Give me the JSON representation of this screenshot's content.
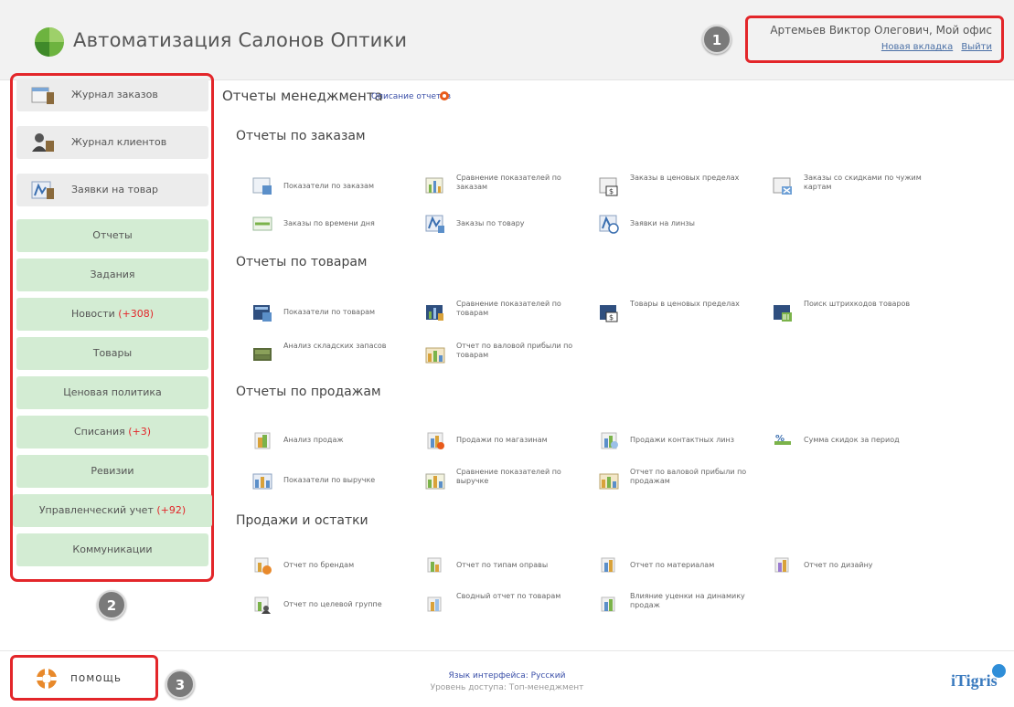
{
  "header": {
    "app_title": "Автоматизация Салонов Оптики",
    "user_name": "Артемьев Виктор Олегович, Мой офис",
    "new_tab": "Новая вкладка",
    "logout": "Выйти"
  },
  "badges": [
    "1",
    "2",
    "3"
  ],
  "sidebar": {
    "main_items": [
      {
        "label": "Журнал заказов",
        "icon": "orders-journal-icon"
      },
      {
        "label": "Журнал клиентов",
        "icon": "clients-journal-icon"
      },
      {
        "label": "Заявки на товар",
        "icon": "product-requests-icon"
      }
    ],
    "items": [
      {
        "label": "Отчеты",
        "count": ""
      },
      {
        "label": "Задания",
        "count": ""
      },
      {
        "label": "Новости",
        "count": "(+308)"
      },
      {
        "label": "Товары",
        "count": ""
      },
      {
        "label": "Ценовая политика",
        "count": ""
      },
      {
        "label": "Списания",
        "count": "(+3)"
      },
      {
        "label": "Ревизии",
        "count": ""
      },
      {
        "label": "Управленческий учет",
        "count": "(+92)"
      },
      {
        "label": "Коммуникации",
        "count": ""
      }
    ]
  },
  "main": {
    "title": "Отчеты менеджмента",
    "subtitle_link": "Описание отчетов",
    "sections": [
      {
        "title": "Отчеты по заказам",
        "reports": [
          "Показатели по заказам",
          "Сравнение показателей по заказам",
          "Заказы в ценовых пределах",
          "Заказы со скидками по чужим картам",
          "Заказы по времени дня",
          "Заказы по товару",
          "Заявки на линзы"
        ]
      },
      {
        "title": "Отчеты по товарам",
        "reports": [
          "Показатели по товарам",
          "Сравнение показателей по товарам",
          "Товары в ценовых пределах",
          "Поиск штрихкодов товаров",
          "Анализ складских запасов",
          "Отчет по валовой прибыли по товарам"
        ]
      },
      {
        "title": "Отчеты по продажам",
        "reports": [
          "Анализ продаж",
          "Продажи по магазинам",
          "Продажи контактных линз",
          "Сумма скидок за период",
          "Показатели по выручке",
          "Сравнение показателей по выручке",
          "Отчет по валовой прибыли по продажам"
        ]
      },
      {
        "title": "Продажи и остатки",
        "reports": [
          "Отчет по брендам",
          "Отчет по типам оправы",
          "Отчет по материалам",
          "Отчет по дизайну",
          "Отчет по целевой группе",
          "Сводный отчет по товарам",
          "Влияние уценки на динамику продаж"
        ]
      }
    ]
  },
  "footer": {
    "help": "помощь",
    "language": "Язык интерфейса: Русский",
    "access_level": "Уровень доступа: Топ-менеджмент",
    "brand": "iTigris"
  },
  "colors": {
    "highlight": "#e3262a",
    "menu_green": "#d3ecd3",
    "link": "#3a4fa8"
  }
}
